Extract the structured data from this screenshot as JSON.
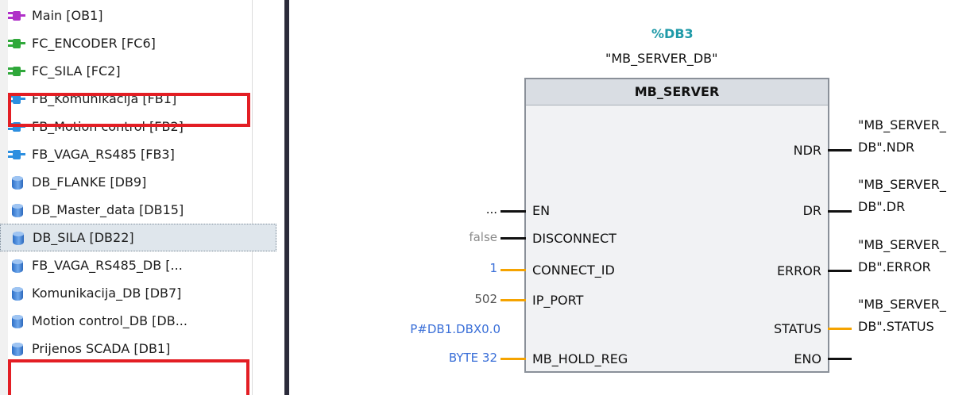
{
  "tree": {
    "items": [
      {
        "label": "Main [OB1]",
        "icon": "ob-block-icon",
        "color": "#b030c8"
      },
      {
        "label": "FC_ENCODER [FC6]",
        "icon": "fc-block-icon",
        "color": "#2fa83a"
      },
      {
        "label": "FC_SILA [FC2]",
        "icon": "fc-block-icon",
        "color": "#2fa83a"
      },
      {
        "label": "FB_Komunikacija [FB1]",
        "icon": "fb-block-icon",
        "color": "#2c8fe0"
      },
      {
        "label": "FB_Motion control [FB2]",
        "icon": "fb-block-icon",
        "color": "#2c8fe0"
      },
      {
        "label": "FB_VAGA_RS485 [FB3]",
        "icon": "fb-block-icon",
        "color": "#2c8fe0"
      },
      {
        "label": "DB_FLANKE [DB9]",
        "icon": "database-icon"
      },
      {
        "label": "DB_Master_data [DB15]",
        "icon": "database-icon"
      },
      {
        "label": "DB_SILA [DB22]",
        "icon": "database-icon",
        "selected": true
      },
      {
        "label": "FB_VAGA_RS485_DB [...",
        "icon": "database-icon"
      },
      {
        "label": "Komunikacija_DB [DB7]",
        "icon": "database-icon"
      },
      {
        "label": "Motion control_DB [DB...",
        "icon": "database-icon"
      },
      {
        "label": "Prijenos SCADA [DB1]",
        "icon": "database-icon"
      }
    ],
    "highlight_color": "#e31e24"
  },
  "block": {
    "db_address": "%DB3",
    "db_name": "\"MB_SERVER_DB\"",
    "title": "MB_SERVER",
    "inputs": {
      "en": {
        "pin": "EN",
        "value": "..."
      },
      "disconnect": {
        "pin": "DISCONNECT",
        "value": "false"
      },
      "connect_id": {
        "pin": "CONNECT_ID",
        "value": "1"
      },
      "ip_port": {
        "pin": "IP_PORT",
        "value": "502"
      },
      "mb_hold_reg": {
        "pin": "MB_HOLD_REG",
        "value_line1": "P#DB1.DBX0.0",
        "value_line2": "BYTE 32"
      }
    },
    "outputs": {
      "ndr": {
        "pin": "NDR",
        "line1": "\"MB_SERVER_",
        "line2": "DB\".NDR"
      },
      "dr": {
        "pin": "DR",
        "line1": "\"MB_SERVER_",
        "line2": "DB\".DR"
      },
      "error": {
        "pin": "ERROR",
        "line1": "\"MB_SERVER_",
        "line2": "DB\".ERROR"
      },
      "status": {
        "pin": "STATUS",
        "line1": "\"MB_SERVER_",
        "line2": "DB\".STATUS"
      },
      "eno": {
        "pin": "ENO"
      }
    },
    "colors": {
      "address": "#1f9aa8",
      "constant": "#3a6fd8",
      "false": "#8a8a8a",
      "bool_wire": "#111111",
      "int_wire": "#f5a300"
    }
  }
}
